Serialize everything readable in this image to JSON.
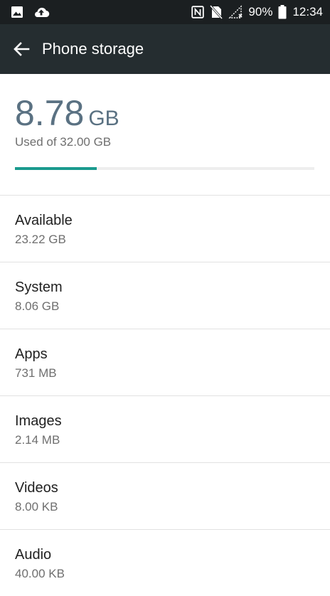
{
  "status_bar": {
    "icons_left": [
      "image-icon",
      "cloud-upload-icon"
    ],
    "icons_right": [
      "nfc-icon",
      "no-sim-icon",
      "signal-icon",
      "battery-icon"
    ],
    "battery": "90%",
    "time": "12:34"
  },
  "app_bar": {
    "title": "Phone storage",
    "back_icon": "arrow-back-icon"
  },
  "summary": {
    "used_value": "8.78",
    "used_unit": "GB",
    "used_of": "Used of 32.00 GB",
    "progress_fraction": 0.274
  },
  "items": [
    {
      "label": "Available",
      "value": "23.22 GB"
    },
    {
      "label": "System",
      "value": "8.06 GB"
    },
    {
      "label": "Apps",
      "value": "731 MB"
    },
    {
      "label": "Images",
      "value": "2.14 MB"
    },
    {
      "label": "Videos",
      "value": "8.00 KB"
    },
    {
      "label": "Audio",
      "value": "40.00 KB"
    }
  ],
  "colors": {
    "status_bar": "#1b1f21",
    "app_bar": "#252d30",
    "accent": "#1a9a8e",
    "used_text": "#5a7182"
  }
}
